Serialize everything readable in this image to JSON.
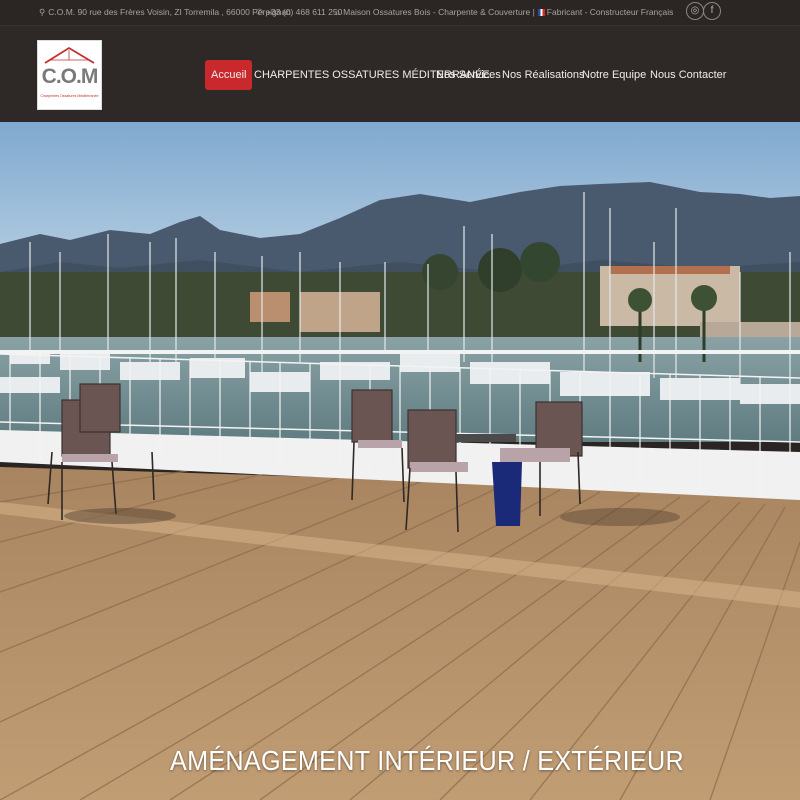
{
  "topbar": {
    "address": "C.O.M. 90 rue des Frères Voisin, ZI Torremila , 66000 Perpignan",
    "phone": "+33 (0) 468 611 250",
    "tagline_part1": "Maison Ossatures Bois - Charpente & Couverture |",
    "tagline_part2": "Fabricant - Constructeur Français",
    "icons": {
      "address": "map-marker-icon",
      "phone": "phone-icon",
      "tagline": "home-icon",
      "social1": "instagram-icon",
      "social2": "facebook-icon"
    }
  },
  "logo": {
    "text": "C.O.M",
    "subtitle": "Charpentes Ossatures Méditerranée"
  },
  "nav": {
    "items": [
      {
        "label": "Accueil",
        "active": true
      },
      {
        "label": "CHARPENTES OSSATURES MÉDITERRANÉE"
      },
      {
        "label": "Nos Services"
      },
      {
        "label": "Nos Réalisations"
      },
      {
        "label": "Notre Equipe"
      },
      {
        "label": "Nous Contacter"
      }
    ]
  },
  "hero": {
    "caption": "AMÉNAGEMENT INTÉRIEUR / EXTÉRIEUR"
  },
  "colors": {
    "topbar_bg": "#2b2624",
    "navbar_bg": "#2e2826",
    "accent": "#c9282d",
    "deck": "#b8936a",
    "sky": "#c7dbe8"
  }
}
